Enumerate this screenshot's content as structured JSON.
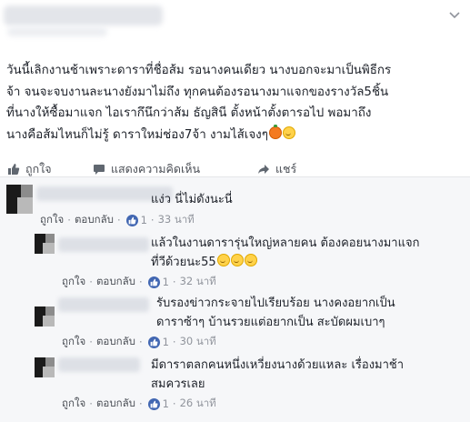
{
  "post": {
    "menu_icon": "chevron-down-icon",
    "body": "วันนี้เลิกงานช้าเพราะดาราที่ชื่อส้ม รอนางคนเดียว นางบอกจะมาเป็นพิธีกร\nจ้า จนจะจบงานละนางยังมาไม่ถึง ทุกคนต้องรอนางมาแจกของรางวัล5ชิ้น\nที่นางให้ซื้อมาแจก ไอเรากึนึกว่าส้ม ธัญสินี ตั้งหน้าตั้งตารอไป พอมาถึง\nนางคือส้มไหนก็ไม่รู้ ดาราใหม่ช่อง7จ้า งามไส้เจงๆ"
  },
  "actions": {
    "like": "ถูกใจ",
    "comment": "แสดงความคิดเห็น",
    "share": "แชร์"
  },
  "comments": [
    {
      "text": "แง่ว นี่ไม่ดังนะนี่",
      "like": "ถูกใจ",
      "reply": "ตอบกลับ",
      "likes": "1",
      "time": "33 นาที"
    },
    {
      "text": "แล้วในงานดารารุ่นใหญ่หลายคน ต้องคอยนางมาแจก\nที่วีด้วยนะ55",
      "like": "ถูกใจ",
      "reply": "ตอบกลับ",
      "likes": "1",
      "time": "32 นาที"
    },
    {
      "text": "รับรองข่าวกระจายไปเรียบร้อย นางคงอยากเป็น\nดาราซ้าๆ บ้านรวยแต่อยากเป็น สะบัดผมเบาๆ",
      "like": "ถูกใจ",
      "reply": "ตอบกลับ",
      "likes": "1",
      "time": "30 นาที"
    },
    {
      "text": "มีดาราตลกคนหนึ่งเหวี่ยงนางด้วยแหละ เรื่องมาช้า\nสมควรเลย",
      "like": "ถูกใจ",
      "reply": "ตอบกลับ",
      "likes": "1",
      "time": "26 นาที"
    }
  ],
  "colors": {
    "accent": "#4267b2",
    "meta": "#90949c",
    "comment_bg": "#f6f7f9"
  }
}
